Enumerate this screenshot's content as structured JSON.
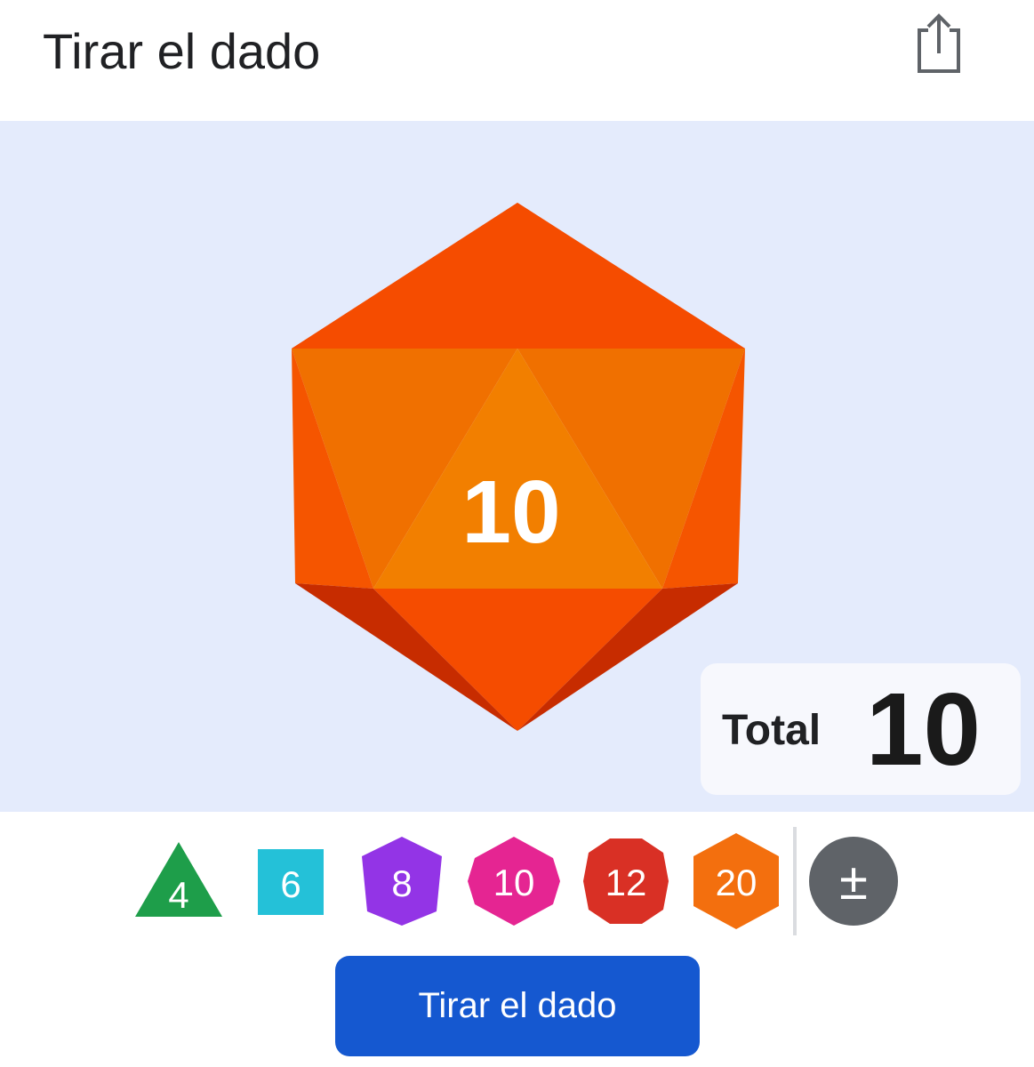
{
  "header": {
    "title": "Tirar el dado",
    "share_icon": "share-icon"
  },
  "stage": {
    "background": "#e4ebfc",
    "current_die": {
      "type": "d20",
      "face_value": "10",
      "color": "#f54c00"
    }
  },
  "total": {
    "label": "Total",
    "value": "10"
  },
  "dice_selector": [
    {
      "label": "4",
      "shape": "triangle",
      "color": "#1e9e4a"
    },
    {
      "label": "6",
      "shape": "square",
      "color": "#24c1d8"
    },
    {
      "label": "8",
      "shape": "hexagon",
      "color": "#9334e6"
    },
    {
      "label": "10",
      "shape": "diamond-hexagon",
      "color": "#e52592"
    },
    {
      "label": "12",
      "shape": "octagon",
      "color": "#d93025"
    },
    {
      "label": "20",
      "shape": "hexagon",
      "color": "#f36f0e"
    },
    {
      "label": "±",
      "shape": "circle",
      "color": "#5f6368"
    }
  ],
  "roll_button": {
    "label": "Tirar el dado",
    "color": "#1558d0"
  }
}
